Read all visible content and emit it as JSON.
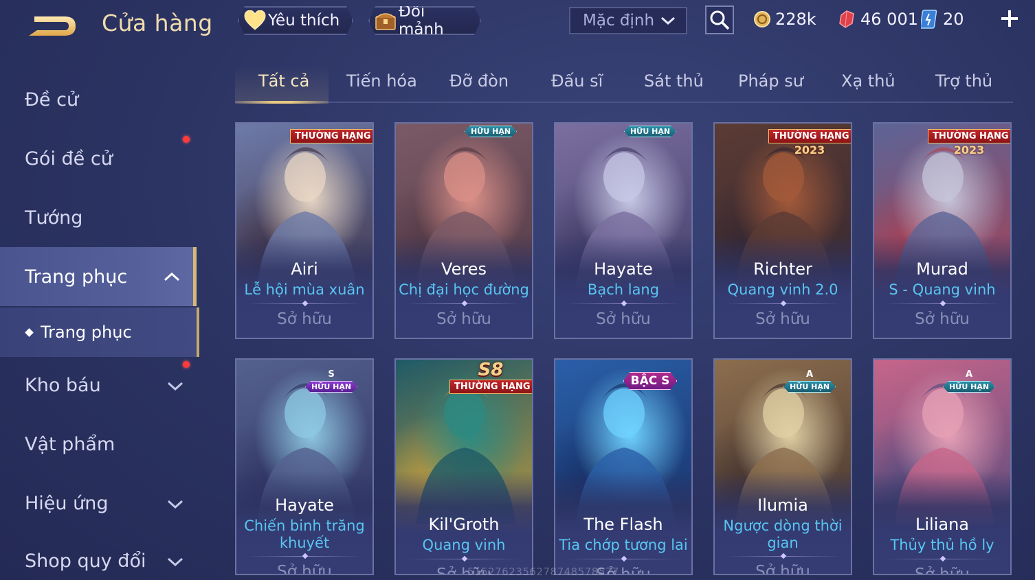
{
  "header": {
    "title": "Cửa hàng",
    "favorites_label": "Yêu thích",
    "exchange_label": "Đổi mảnh",
    "sort_label": "Mặc định",
    "gold_amount": "228k",
    "gem_amount": "46 001",
    "voucher_amount": "20"
  },
  "sidebar": {
    "items": [
      {
        "label": "Đề cử",
        "badge": false
      },
      {
        "label": "Gói đề cử",
        "badge": true
      },
      {
        "label": "Tướng",
        "badge": false
      },
      {
        "label": "Trang phục",
        "expanded": true
      },
      {
        "label": "Trang phục",
        "sub": true
      },
      {
        "label": "Kho báu",
        "badge": true
      },
      {
        "label": "Vật phẩm",
        "badge": false
      },
      {
        "label": "Hiệu ứng",
        "badge": false
      },
      {
        "label": "Shop quy đổi",
        "badge": false
      }
    ]
  },
  "tabs": [
    {
      "label": "Tất cả",
      "active": true
    },
    {
      "label": "Tiến hóa"
    },
    {
      "label": "Đỡ đòn"
    },
    {
      "label": "Đấu sĩ"
    },
    {
      "label": "Sát thủ"
    },
    {
      "label": "Pháp sư"
    },
    {
      "label": "Xạ thủ"
    },
    {
      "label": "Trợ thủ"
    }
  ],
  "cards": [
    {
      "hero": "Airi",
      "skin": "Lễ hội mùa xuân",
      "skin2": "",
      "status": "Sở hữu",
      "badge": "THƯỜNG HẠNG",
      "badge_type": "rank",
      "palette": [
        "#e8d6c4",
        "#6d7aa8",
        "#3a2a3c"
      ]
    },
    {
      "hero": "Veres",
      "skin": "Chị đại học đường",
      "skin2": "",
      "status": "Sở hữu",
      "badge": "HỮU HẠN",
      "badge_type": "ltd",
      "palette": [
        "#d98f87",
        "#7b5a67",
        "#4d3440"
      ]
    },
    {
      "hero": "Hayate",
      "skin": "Bạch lang",
      "skin2": "",
      "status": "Sở hữu",
      "badge": "HỮU HẠN",
      "badge_type": "ltd",
      "palette": [
        "#c7c7e6",
        "#7b6fa0",
        "#3a3560"
      ]
    },
    {
      "hero": "Richter",
      "skin": "Quang vinh 2.0",
      "skin2": "",
      "status": "Sở hữu",
      "badge": "THƯỜNG HẠNG",
      "badge_year": "2023",
      "badge_type": "rank",
      "palette": [
        "#a35a3a",
        "#5b3b34",
        "#2f2430"
      ]
    },
    {
      "hero": "Murad",
      "skin": "S - Quang vinh",
      "skin2": "",
      "status": "Sở hữu",
      "badge": "THƯỜNG HẠNG",
      "badge_year": "2023",
      "badge_type": "rank",
      "palette": [
        "#c6c4d8",
        "#5d6496",
        "#b03c4b"
      ]
    },
    {
      "hero": "Hayate",
      "skin": "Chiến binh trăng",
      "skin2": "khuyết",
      "status": "Sở hữu",
      "badge": "HỮU HẠN",
      "badge_tier": "S",
      "badge_type": "s",
      "palette": [
        "#8ec8e2",
        "#54608e",
        "#2b2f5c"
      ]
    },
    {
      "hero": "Kil'Groth",
      "skin": "Quang vinh",
      "skin2": "",
      "status": "Sở hữu",
      "badge": "THƯỜNG HẠNG",
      "badge_tier": "S8",
      "badge_type": "rank",
      "palette": [
        "#2d8a82",
        "#1f5a67",
        "#d4a53a"
      ]
    },
    {
      "hero": "The Flash",
      "skin": "Tia chớp tương lai",
      "skin2": "",
      "status": "Sở hữu",
      "badge": "BẬC S",
      "badge_type": "bacs",
      "palette": [
        "#6fd2ff",
        "#2a5fa8",
        "#152a5e"
      ]
    },
    {
      "hero": "Ilumia",
      "skin": "Ngược dòng thời",
      "skin2": "gian",
      "status": "Sở hữu",
      "badge": "HỮU HẠN",
      "badge_tier": "A",
      "badge_type": "ltd",
      "palette": [
        "#e0cfa4",
        "#8c6e4e",
        "#3b2b2a"
      ]
    },
    {
      "hero": "Liliana",
      "skin": "Thủy thủ hồ ly",
      "skin2": "",
      "status": "Sở hữu",
      "badge": "HỮU HẠN",
      "badge_tier": "A",
      "badge_type": "ltd",
      "palette": [
        "#e5a0b6",
        "#c6658a",
        "#46477b"
      ]
    }
  ],
  "watermark": "5152762356278748578577",
  "colors": {
    "accent_gold": "#e8c982",
    "skin_blue": "#58c6f2",
    "notify_red": "#ff3b3b"
  }
}
